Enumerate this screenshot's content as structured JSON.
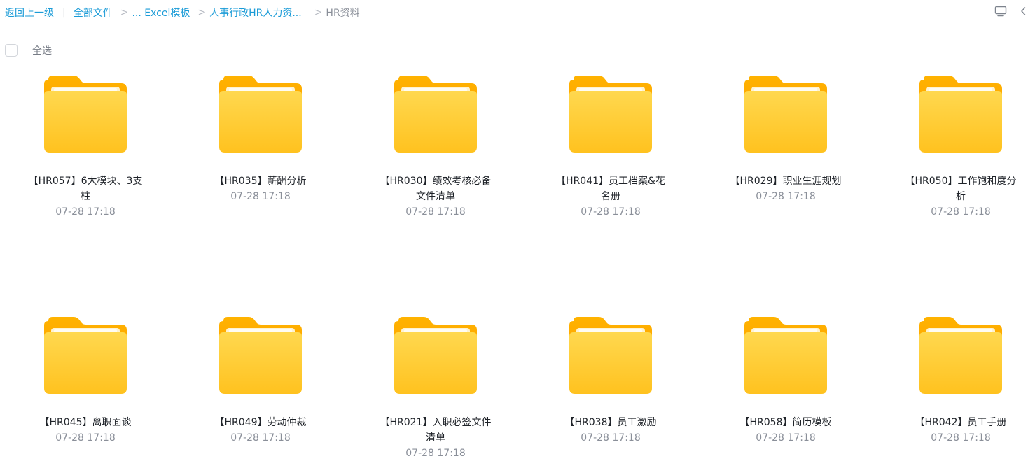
{
  "breadcrumb": {
    "back_label": "返回上一级",
    "separator_pipe": "|",
    "separator": ">",
    "items": [
      {
        "label": "全部文件"
      },
      {
        "label": "... Excel模板"
      },
      {
        "label": "人事行政HR人力资..."
      }
    ],
    "current": "HR资料"
  },
  "toolbar": {
    "icons": [
      "screen-icon",
      "chevron-left-icon"
    ]
  },
  "select_all": {
    "label": "全选",
    "checked": false
  },
  "colors": {
    "link": "#1a9bd7",
    "folder_top": "#FFD24D",
    "folder_body": "#FFC928",
    "muted_text": "#8a8f99"
  },
  "folders": [
    {
      "name": "【HR057】6大模块、3支柱",
      "time": "07-28 17:18"
    },
    {
      "name": "【HR035】薪酬分析",
      "time": "07-28 17:18"
    },
    {
      "name": "【HR030】绩效考核必备文件清单",
      "time": "07-28 17:18"
    },
    {
      "name": "【HR041】员工档案&花名册",
      "time": "07-28 17:18"
    },
    {
      "name": "【HR029】职业生涯规划",
      "time": "07-28 17:18"
    },
    {
      "name": "【HR050】工作饱和度分析",
      "time": "07-28 17:18"
    },
    {
      "name": "【HR045】离职面谈",
      "time": "07-28 17:18"
    },
    {
      "name": "【HR049】劳动仲裁",
      "time": "07-28 17:18"
    },
    {
      "name": "【HR021】入职必签文件清单",
      "time": "07-28 17:18"
    },
    {
      "name": "【HR038】员工激励",
      "time": "07-28 17:18"
    },
    {
      "name": "【HR058】简历模板",
      "time": "07-28 17:18"
    },
    {
      "name": "【HR042】员工手册",
      "time": "07-28 17:18"
    }
  ]
}
